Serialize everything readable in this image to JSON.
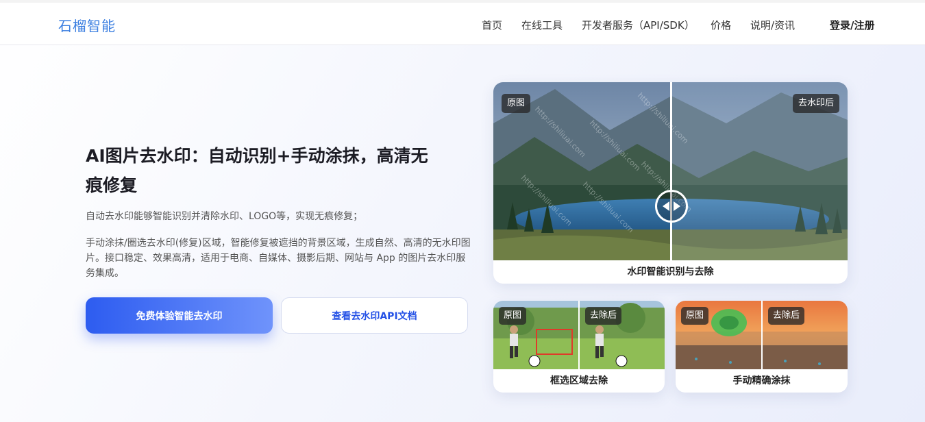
{
  "nav": {
    "brand": "石榴智能",
    "items": [
      "首页",
      "在线工具",
      "开发者服务（API/SDK）",
      "价格",
      "说明/资讯"
    ],
    "login": "登录/注册"
  },
  "hero": {
    "title_line1": "AI图片去水印：自动识别+手动涂抹，高清无",
    "title_line2": "痕修复",
    "desc1": "自动去水印能够智能识别并清除水印、LOGO等，实现无痕修复；",
    "desc2": "手动涂抹/圈选去水印(修复)区域，智能修复被遮挡的背景区域，生成自然、高清的无水印图片。接口稳定、效果高清，适用于电商、自媒体、摄影后期、网站与 App 的图片去水印服务集成。",
    "btn_primary": "免费体验智能去水印",
    "btn_secondary": "查看去水印API文档"
  },
  "showcase": {
    "main": {
      "before": "原图",
      "after": "去水印后",
      "caption": "水印智能识别与去除",
      "watermark": "http://shiliuai.com"
    },
    "small1": {
      "before": "原图",
      "after": "去除后",
      "caption": "框选区域去除"
    },
    "small2": {
      "before": "原图",
      "after": "去除后",
      "caption": "手动精确涂抹"
    }
  },
  "colors": {
    "brand": "#3a7ee0",
    "primary": "#2d5cf0",
    "secondary_text": "#2451e6"
  }
}
